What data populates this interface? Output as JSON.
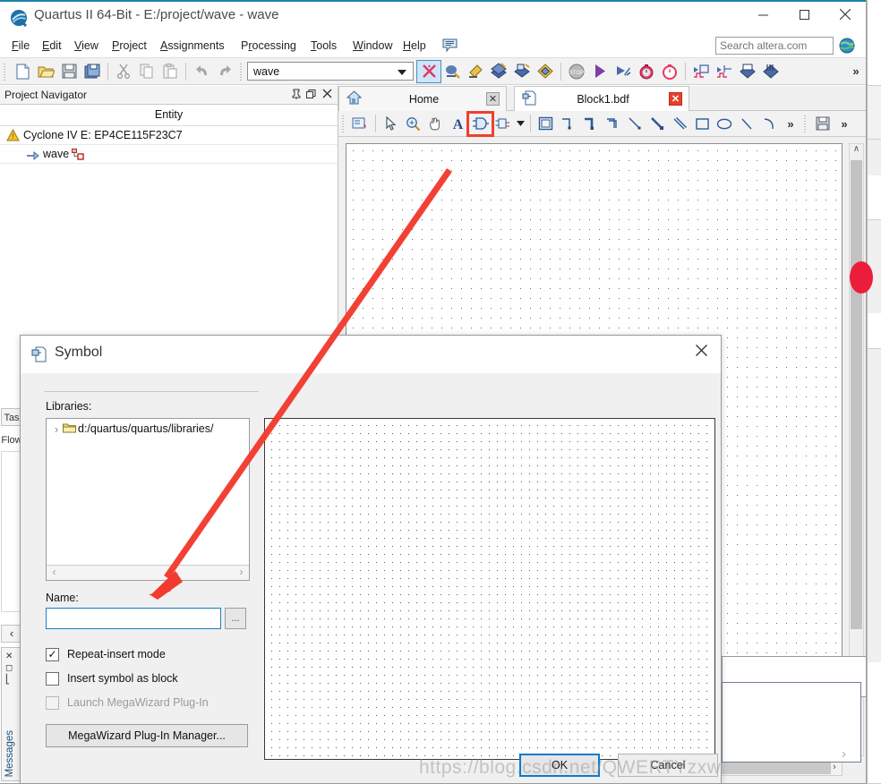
{
  "window": {
    "title": "Quartus II 64-Bit - E:/project/wave - wave",
    "app_icon": "quartus-logo-icon",
    "minimize_label": "—",
    "maximize_label": "□",
    "close_label": "✕"
  },
  "menubar": {
    "items": [
      {
        "label": "File",
        "mnemonic": "F"
      },
      {
        "label": "Edit",
        "mnemonic": "E"
      },
      {
        "label": "View",
        "mnemonic": "V"
      },
      {
        "label": "Project",
        "mnemonic": "P"
      },
      {
        "label": "Assignments",
        "mnemonic": "A"
      },
      {
        "label": "Processing",
        "mnemonic": "r"
      },
      {
        "label": "Tools",
        "mnemonic": "T"
      },
      {
        "label": "Window",
        "mnemonic": "W"
      },
      {
        "label": "Help",
        "mnemonic": "H"
      }
    ],
    "comment_icon": "comment-balloon-icon",
    "search_placeholder": "Search altera.com",
    "search_value": "",
    "globe_icon": "globe-icon"
  },
  "toolbar": {
    "project_combo_value": "wave",
    "overflow_label": "»",
    "icons": [
      "new-file-icon",
      "open-folder-icon",
      "save-icon",
      "save-all-icon",
      "cut-icon",
      "copy-icon",
      "paste-icon",
      "undo-icon",
      "redo-icon"
    ],
    "run_icons": [
      "stop-compile-icon",
      "analysis-synthesis-icon",
      "fitter-icon",
      "assembler-icon",
      "timing-analyzer-icon",
      "programmer-icon",
      "stop-icon",
      "start-compilation-icon",
      "start-analysis-icon",
      "timequest-icon",
      "timequest-2-icon",
      "waveform-in-icon",
      "waveform-out-icon",
      "download-icon",
      "download-2-icon"
    ]
  },
  "project_navigator": {
    "title": "Project Navigator",
    "pin_icon": "pin-icon",
    "float_icon": "restore-icon",
    "close_icon": "close-icon",
    "column_header": "Entity",
    "rows": [
      {
        "icon": "warning-triangle-icon",
        "label": "Cyclone IV E: EP4CE115F23C7",
        "indent": 6
      },
      {
        "icon": "entity-arrow-icon",
        "label": "wave",
        "indent": 30,
        "badge": "hierarchy-icon"
      }
    ]
  },
  "left_strip": {
    "tabs": [
      "Tas",
      "Flow"
    ],
    "collapse_label": "‹",
    "messages_label": "Messages",
    "messages_icons": [
      "✕",
      "❐",
      "⏐"
    ]
  },
  "editor": {
    "tabs": [
      {
        "label": "Home",
        "icon": "home-icon",
        "active": false,
        "close": "✕",
        "close_style": "grey"
      },
      {
        "label": "Block1.bdf",
        "icon": "bdf-file-icon",
        "active": true,
        "close": "✕",
        "close_style": "red"
      }
    ],
    "bdf_toolbar_icons": [
      "select-tool-icon",
      "zoom-tool-icon",
      "hand-tool-icon",
      "text-tool-icon",
      "symbol-tool-icon",
      "block-tool-icon",
      "dropdown-arrow-icon",
      "rectangle-select-icon",
      "orthogonal-node-line-icon",
      "orthogonal-bus-line-icon",
      "orthogonal-conduit-line-icon",
      "diagonal-node-line-icon",
      "diagonal-bus-line-icon",
      "diagonal-conduit-line-icon",
      "rectangle-icon",
      "oval-icon",
      "line-icon",
      "arc-icon"
    ],
    "bdf_overflow_label": "»",
    "save_icon": "save-icon",
    "save_overflow_label": "»",
    "highlighted_tool": "symbol-tool-icon",
    "scroll_up_label": "∧",
    "scroll_down_label": "∨",
    "scroll_left_label": "‹",
    "scroll_right_label": "›"
  },
  "symbol_dialog": {
    "title": "Symbol",
    "icon": "symbol-dialog-icon",
    "close_label": "✕",
    "libraries_label": "Libraries:",
    "library_items": [
      {
        "chevron": "›",
        "icon": "folder-icon",
        "label": "d:/quartus/quartus/libraries/"
      }
    ],
    "lib_scroll_left": "‹",
    "lib_scroll_right": "›",
    "name_label": "Name:",
    "name_value": "",
    "name_placeholder": "",
    "browse_label": "...",
    "checkboxes": [
      {
        "label": "Repeat-insert mode",
        "checked": true,
        "enabled": true,
        "mark": "✓"
      },
      {
        "label": "Insert symbol as block",
        "checked": false,
        "enabled": true,
        "mark": ""
      },
      {
        "label": "Launch MegaWizard Plug-In",
        "checked": false,
        "enabled": false,
        "mark": ""
      }
    ],
    "megawizard_button": "MegaWizard Plug-In Manager...",
    "ok_label": "OK",
    "cancel_label": "Cancel"
  },
  "annotation": {
    "arrow_color": "#f23b2f",
    "arrow_from": "symbol-tool-icon",
    "arrow_to": "name-input"
  },
  "watermark": {
    "text": "https://blog.csdn.net/QWERTYzxw"
  },
  "colors": {
    "accent": "#1f7fa8",
    "focus_blue": "#0a7ad0",
    "tab_close_red": "#e8402a",
    "annotation_red": "#f23b2f"
  }
}
